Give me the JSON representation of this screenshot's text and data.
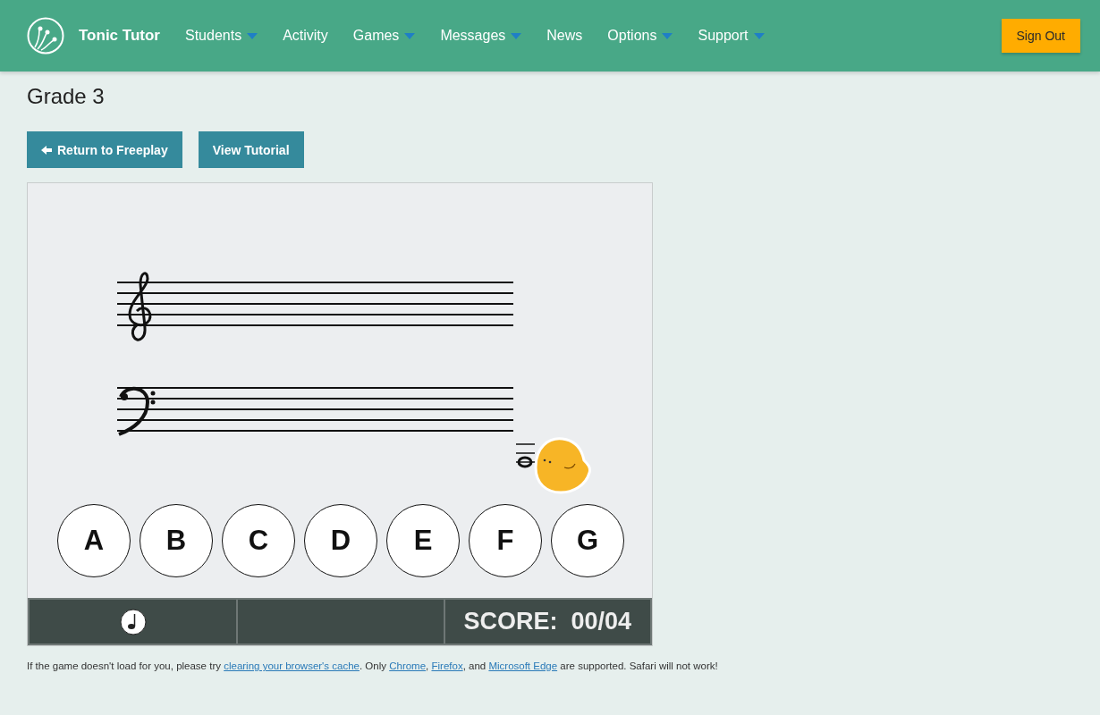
{
  "nav": {
    "brand": "Tonic Tutor",
    "items": [
      {
        "label": "Students",
        "dropdown": true
      },
      {
        "label": "Activity",
        "dropdown": false
      },
      {
        "label": "Games",
        "dropdown": true
      },
      {
        "label": "Messages",
        "dropdown": true
      },
      {
        "label": "News",
        "dropdown": false
      },
      {
        "label": "Options",
        "dropdown": true
      },
      {
        "label": "Support",
        "dropdown": true
      }
    ],
    "sign_out": "Sign Out"
  },
  "subtitle": "Grade 3",
  "buttons": [
    {
      "label": "Return to Freeplay",
      "kind": "back"
    },
    {
      "label": "View Tutorial",
      "kind": "plain"
    }
  ],
  "game": {
    "answers": [
      "A",
      "B",
      "C",
      "D",
      "E",
      "F",
      "G"
    ],
    "score": {
      "label": "SCORE:",
      "value": "00/04"
    }
  },
  "footer": [
    {
      "kind": "text",
      "text": "If the game doesn't load for you, please try "
    },
    {
      "kind": "link",
      "text": "clearing your browser's cache"
    },
    {
      "kind": "text",
      "text": ". Only "
    },
    {
      "kind": "link",
      "text": "Chrome"
    },
    {
      "kind": "text",
      "text": ", "
    },
    {
      "kind": "link",
      "text": "Firefox"
    },
    {
      "kind": "text",
      "text": ", and "
    },
    {
      "kind": "link",
      "text": "Microsoft Edge"
    },
    {
      "kind": "text",
      "text": " are supported. Safari will not work!"
    }
  ]
}
